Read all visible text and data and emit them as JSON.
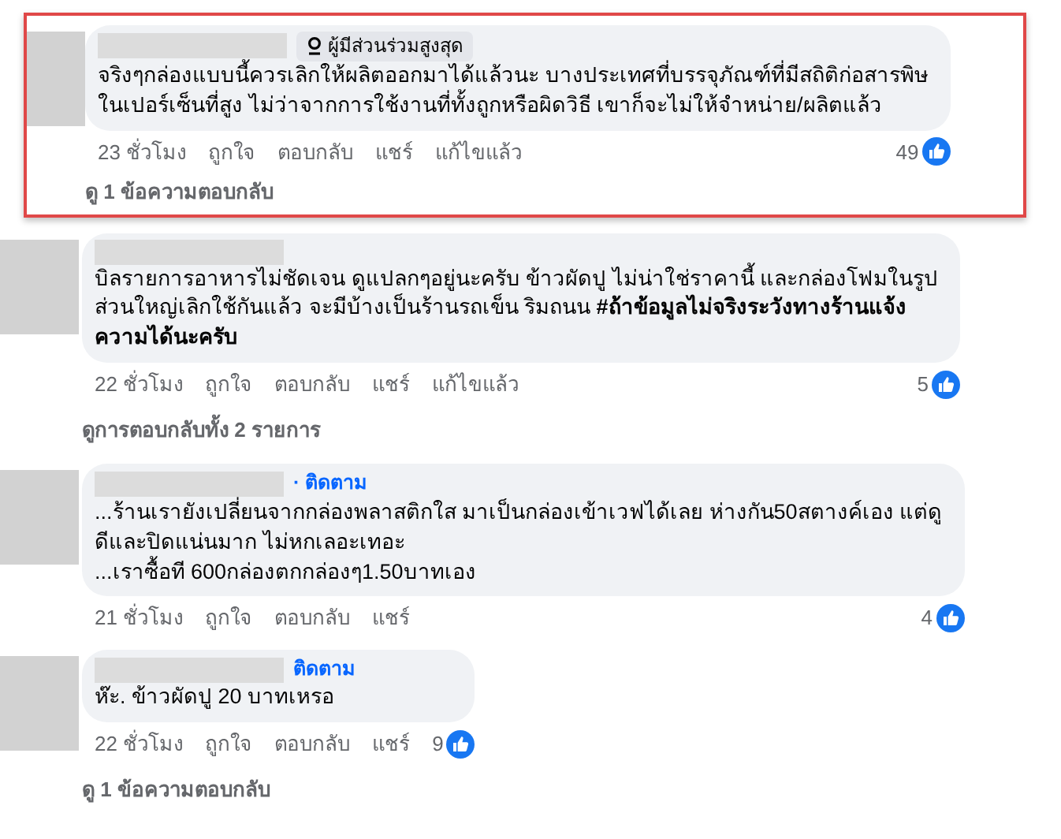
{
  "comments": [
    {
      "highlighted": true,
      "badge": "ผู้มีส่วนร่วมสูงสุด",
      "text": "จริงๆกล่องแบบนี้ควรเลิกให้ผลิตออกมาได้แล้วนะ บางประเทศที่บรรจุภัณฑ์ที่มีสถิติก่อสารพิษ\nในเปอร์เซ็นที่สูง ไม่ว่าจากการใช้งานที่ทั้งถูกหรือผิดวิธี เขาก็จะไม่ให้จำหน่าย/ผลิตแล้ว",
      "time": "23 ชั่วโมง",
      "actions": [
        "ถูกใจ",
        "ตอบกลับ",
        "แชร์",
        "แก้ไขแล้ว"
      ],
      "reactions": "49",
      "replies": "ดู 1 ข้อความตอบกลับ"
    },
    {
      "highlighted": false,
      "text": "บิลรายการอาหารไม่ชัดเจน ดูแปลกๆอยู่นะครับ ข้าวผัดปู ไม่น่าใช่ราคานี้ และกล่องโฟมในรูป\nส่วนใหญ่เลิกใช้กันแล้ว จะมีบ้างเป็นร้านรถเข็น ริมถนน **#ถ้าข้อมูลไม่จริงระวังทางร้านแจ้ง\nความได้นะครับ**",
      "time": "22 ชั่วโมง",
      "actions": [
        "ถูกใจ",
        "ตอบกลับ",
        "แชร์",
        "แก้ไขแล้ว"
      ],
      "reactions": "5",
      "replies": "ดูการตอบกลับทั้ง 2 รายการ"
    },
    {
      "highlighted": false,
      "follow": "· ติดตาม",
      "text": "...ร้านเรายังเปลี่ยนจากกล่องพลาสติกใส มาเป็นกล่องเข้าเวฟได้เลย ห่างกัน50สตางค์เอง แต่ดู\nดีและปิดแน่นมาก ไม่หกเลอะเทอะ\n...เราซื้อที 600กล่องตกกล่องๆ1.50บาทเอง",
      "time": "21 ชั่วโมง",
      "actions": [
        "ถูกใจ",
        "ตอบกลับ",
        "แชร์"
      ],
      "reactions": "4"
    },
    {
      "highlighted": false,
      "follow": "ติดตาม",
      "text": "ห๊ะ. ข้าวผัดปู 20 บาทเหรอ",
      "time": "22 ชั่วโมง",
      "actions": [
        "ถูกใจ",
        "ตอบกลับ",
        "แชร์"
      ],
      "reactions": "9",
      "replies": "ดู 1 ข้อความตอบกลับ"
    }
  ]
}
